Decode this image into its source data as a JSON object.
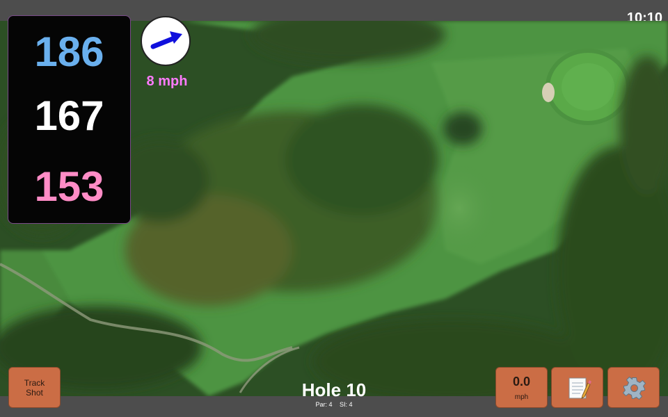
{
  "status_bar": {
    "time": "10:10"
  },
  "yardage": {
    "back": "186",
    "middle": "167",
    "front": "153"
  },
  "wind": {
    "speed": "8 mph"
  },
  "hole": {
    "title": "Hole 10",
    "par": "Par: 4",
    "si": "SI: 4"
  },
  "buttons": {
    "track_shot": "Track Shot",
    "speed_value": "0.0",
    "speed_unit": "mph",
    "notes_icon": "notepad-icon",
    "settings_icon": "gear-icon"
  },
  "colors": {
    "back_yardage": "#6ab0ee",
    "middle_yardage": "#ffffff",
    "front_yardage": "#ff8cc6",
    "wind_text": "#ff7bff",
    "button": "#cb6d45",
    "wind_arrow": "#1010dd"
  }
}
